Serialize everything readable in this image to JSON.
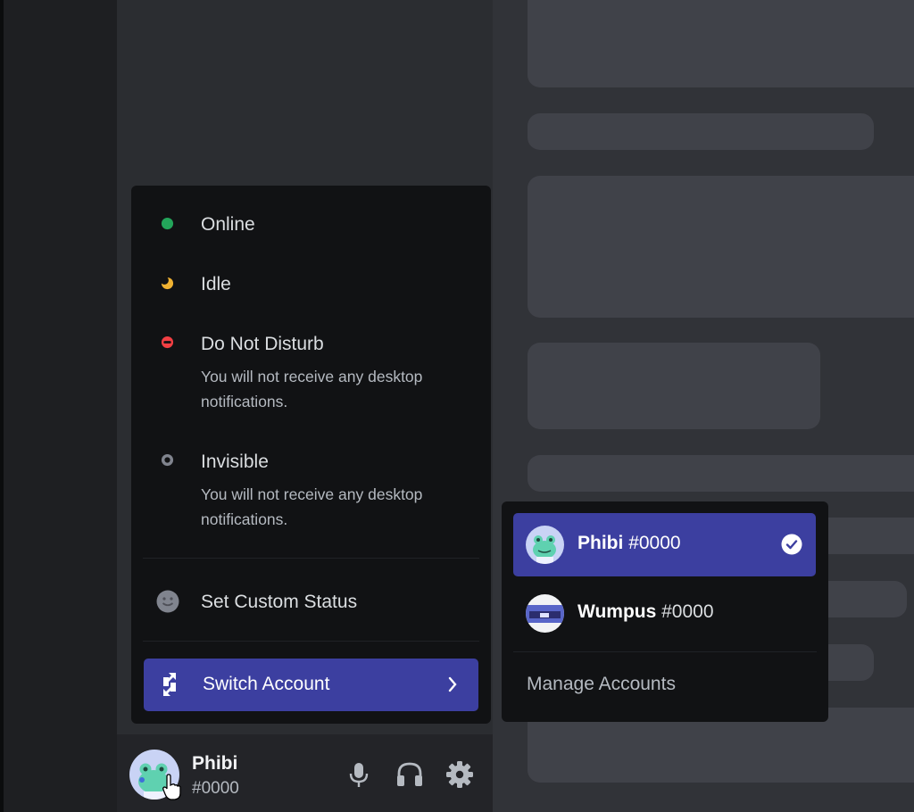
{
  "status_menu": {
    "items": [
      {
        "label": "Online",
        "color": "#23a55a"
      },
      {
        "label": "Idle",
        "color": "#f0b232"
      },
      {
        "label": "Do Not Disturb",
        "description": "You will not receive any desktop notifications.",
        "color": "#f23f43"
      },
      {
        "label": "Invisible",
        "description": "You will not receive any desktop notifications.",
        "color": "#80848e"
      }
    ],
    "custom_status_label": "Set Custom Status",
    "switch_account_label": "Switch Account"
  },
  "accounts_menu": {
    "accounts": [
      {
        "name": "Phibi",
        "tag": "#0000",
        "selected": true
      },
      {
        "name": "Wumpus",
        "tag": "#0000",
        "selected": false
      }
    ],
    "manage_label": "Manage Accounts"
  },
  "user_panel": {
    "name": "Phibi",
    "tag": "#0000",
    "status": "online"
  },
  "colors": {
    "accent": "#3c3fa0",
    "online": "#23a55a",
    "idle": "#f0b232",
    "dnd": "#f23f43",
    "invisible": "#80848e"
  }
}
